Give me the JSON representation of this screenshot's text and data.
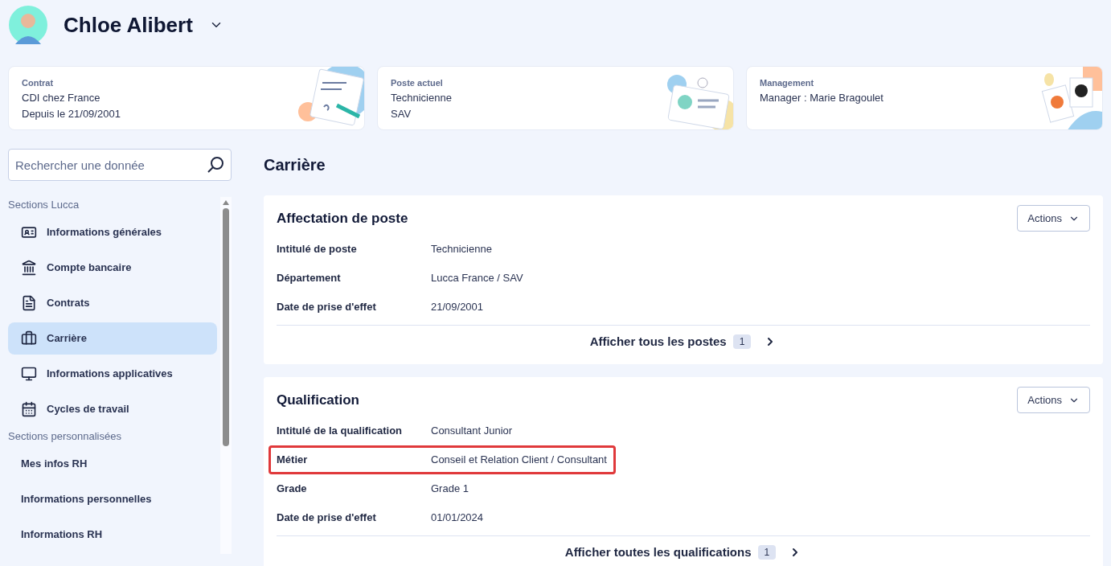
{
  "header": {
    "name": "Chloe Alibert"
  },
  "summary_cards": [
    {
      "title": "Contrat",
      "lines": [
        "CDI chez France",
        "Depuis le 21/09/2001"
      ],
      "kind": "contract"
    },
    {
      "title": "Poste actuel",
      "lines": [
        "Technicienne",
        "SAV"
      ],
      "kind": "badge"
    },
    {
      "title": "Management",
      "lines": [
        "Manager : Marie Bragoulet"
      ],
      "kind": "photos"
    }
  ],
  "search": {
    "placeholder": "Rechercher une donnée"
  },
  "sidebar": {
    "groups": [
      {
        "title": "Sections Lucca",
        "kind": "icons",
        "items": [
          {
            "label": "Informations générales",
            "selected": false
          },
          {
            "label": "Compte bancaire",
            "selected": false
          },
          {
            "label": "Contrats",
            "selected": false
          },
          {
            "label": "Carrière",
            "selected": true
          },
          {
            "label": "Informations applicatives",
            "selected": false
          },
          {
            "label": "Cycles de travail",
            "selected": false
          }
        ]
      },
      {
        "title": "Sections personnalisées",
        "kind": "plain",
        "items": [
          {
            "label": "Mes infos RH",
            "selected": false
          },
          {
            "label": "Informations personnelles",
            "selected": false
          },
          {
            "label": "Informations RH",
            "selected": false
          }
        ]
      }
    ]
  },
  "page_title": "Carrière",
  "sections": [
    {
      "title": "Affectation de poste",
      "actions": "Actions",
      "fields": [
        {
          "label": "Intitulé de poste",
          "value": "Technicienne",
          "highlighted": false
        },
        {
          "label": "Département",
          "value": "Lucca France / SAV",
          "highlighted": false
        },
        {
          "label": "Date de prise d'effet",
          "value": "21/09/2001",
          "highlighted": false
        }
      ],
      "footer_link": "Afficher tous les postes",
      "count": "1"
    },
    {
      "title": "Qualification",
      "actions": "Actions",
      "fields": [
        {
          "label": "Intitulé de la qualification",
          "value": "Consultant Junior",
          "highlighted": false
        },
        {
          "label": "Métier",
          "value": "Conseil et Relation Client / Consultant",
          "highlighted": true
        },
        {
          "label": "Grade",
          "value": "Grade 1",
          "highlighted": false
        },
        {
          "label": "Date de prise d'effet",
          "value": "01/01/2024",
          "highlighted": false
        }
      ],
      "footer_link": "Afficher toutes les qualifications",
      "count": "1"
    }
  ]
}
